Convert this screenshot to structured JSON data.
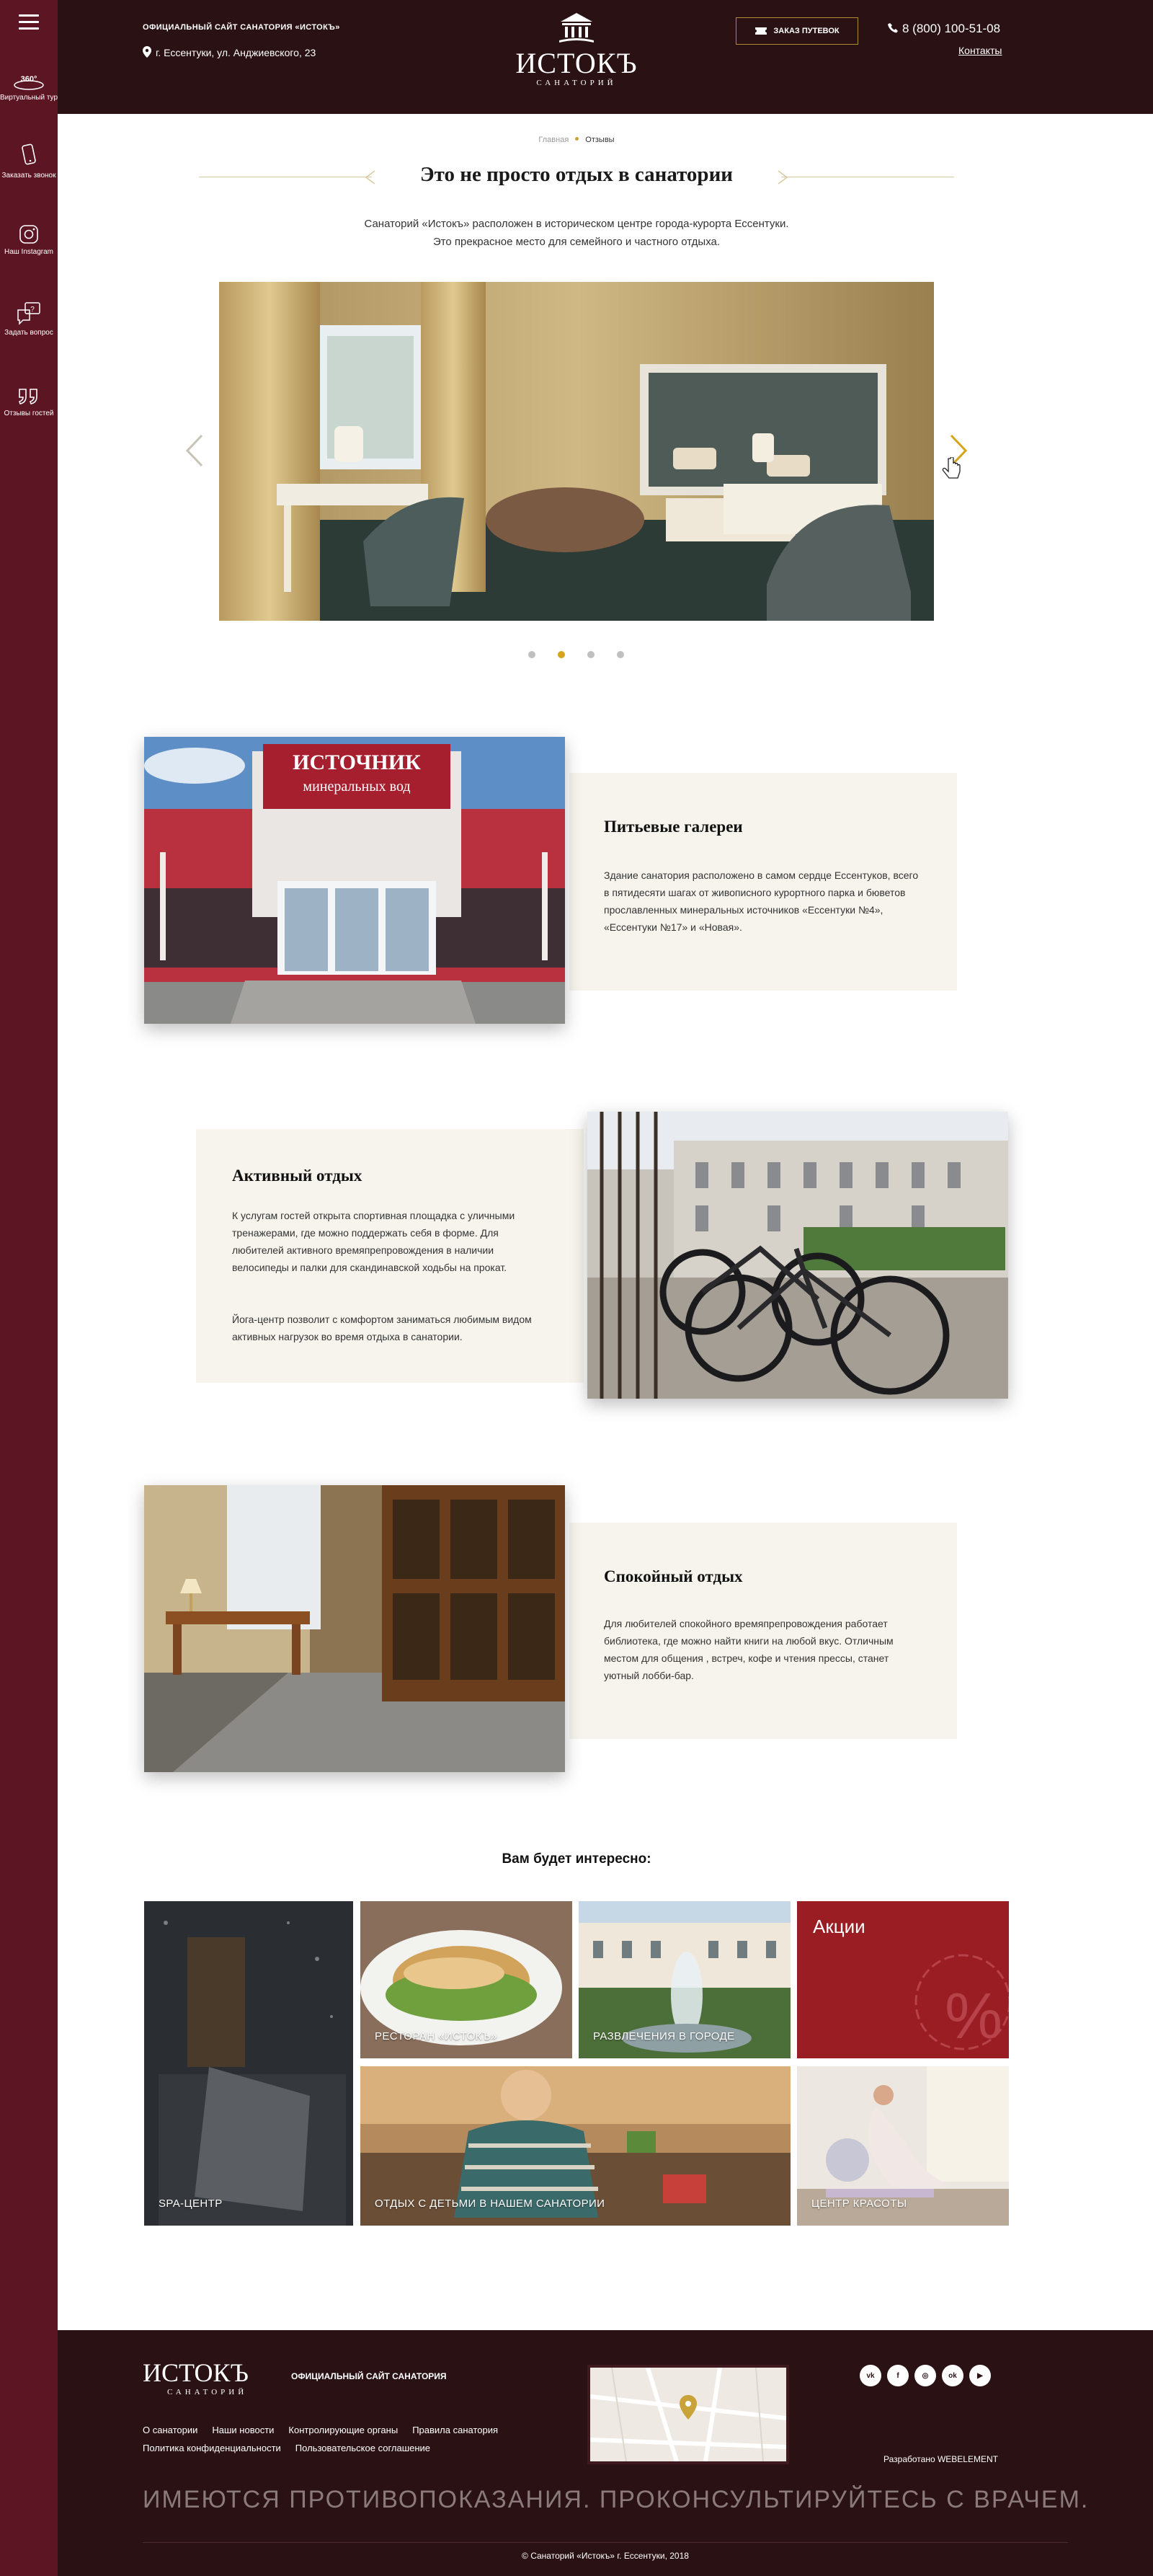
{
  "sidebar": {
    "menu_icon": "hamburger-icon",
    "items": [
      {
        "icon": "360-icon",
        "badge": "360°",
        "label": "Виртуальный тур"
      },
      {
        "icon": "phone-icon",
        "label": "Заказать звонок"
      },
      {
        "icon": "instagram-icon",
        "label": "Наш Instagram"
      },
      {
        "icon": "question-icon",
        "label": "Задать вопрос"
      },
      {
        "icon": "quote-icon",
        "label": "Отзывы гостей"
      }
    ],
    "background": "#5c1522"
  },
  "header": {
    "site_label": "ОФИЦИАЛЬНЫЙ САЙТ САНАТОРИЯ «ИСТОКЪ»",
    "address": "г. Ессентуки, ул. Анджиевского, 23",
    "logo_name": "ИСТОКЪ",
    "logo_sub": "САНАТОРИЙ",
    "order_button": "ЗАКАЗ ПУТЕВОК",
    "phone": "8 (800) 100-51-08",
    "contacts_link": "Контакты",
    "background": "#2a1214",
    "accent": "#b08a2e"
  },
  "breadcrumbs": {
    "home": "Главная",
    "current": "Отзывы"
  },
  "page": {
    "title": "Это не просто отдых в санатории",
    "intro_line1": "Санаторий «Истокъ» расположен в историческом центре города-курорта Ессентуки.",
    "intro_line2": "Это прекрасное место для семейного и частного отдыха."
  },
  "slider": {
    "slides_count": 4,
    "active_index": 1,
    "prev_icon": "chevron-left-icon",
    "next_icon": "chevron-right-icon"
  },
  "features": [
    {
      "title": "Питьевые галереи",
      "text": "Здание санатория расположено в самом сердце Ессентуков, всего в пятидесяти шагах от живописного курортного парка и бюветов прославленных минеральных источников «Ессентуки №4», «Ессентуки №17» и «Новая».",
      "image_sign_line1": "ИСТОЧНИК",
      "image_sign_line2": "минеральных вод"
    },
    {
      "title": "Активный отдых",
      "text": "К услугам гостей открыта спортивная площадка с уличными тренажерами, где можно поддержать себя в форме. Для любителей активного времяпрепровождения в наличии велосипеды и палки для скандинавской ходьбы на прокат.",
      "text2": "Йога-центр позволит с комфортом заниматься любимым видом активных нагрузок во время отдыха в санатории."
    },
    {
      "title": "Спокойный отдых",
      "text": "Для любителей спокойного времяпрепровождения работает библиотека, где можно найти книги на любой вкус. Отличным местом для общения , встреч, кофе и чтения прессы, станет уютный лобби-бар."
    }
  ],
  "interest": {
    "heading": "Вам будет интересно:",
    "tiles": [
      {
        "label": "SPA-ЦЕНТР"
      },
      {
        "label": "РЕСТОРАН «ИСТОКЪ»"
      },
      {
        "label": "РАЗВЛЕЧЕНИЯ В ГОРОДЕ"
      },
      {
        "label": "Акции",
        "symbol": "%"
      },
      {
        "label": "ОТДЫХ С ДЕТЬМИ В НАШЕМ САНАТОРИИ"
      },
      {
        "label": "ЦЕНТР КРАСОТЫ"
      }
    ]
  },
  "footer": {
    "logo_name": "ИСТОКЪ",
    "logo_sub": "САНАТОРИЙ",
    "site_label": "ОФИЦИАЛЬНЫЙ САЙТ САНАТОРИЯ",
    "links_row1": [
      "О санатории",
      "Наши новости",
      "Контролирующие органы",
      "Правила санатория"
    ],
    "links_row2": [
      "Политика конфиденциальности",
      "Пользовательское соглашение"
    ],
    "social": [
      {
        "icon": "vk-icon",
        "text": "vk"
      },
      {
        "icon": "facebook-icon",
        "text": "f"
      },
      {
        "icon": "instagram-icon",
        "text": "◎"
      },
      {
        "icon": "odnoklassniki-icon",
        "text": "ok"
      },
      {
        "icon": "youtube-icon",
        "text": "▶"
      }
    ],
    "developer": "Разработано WEBELEMENT",
    "warning": "ИМЕЮТСЯ ПРОТИВОПОКАЗАНИЯ. ПРОКОНСУЛЬТИРУЙТЕСЬ С ВРАЧЕМ.",
    "copyright": "© Санаторий «Истокъ» г. Ессентуки, 2018"
  }
}
